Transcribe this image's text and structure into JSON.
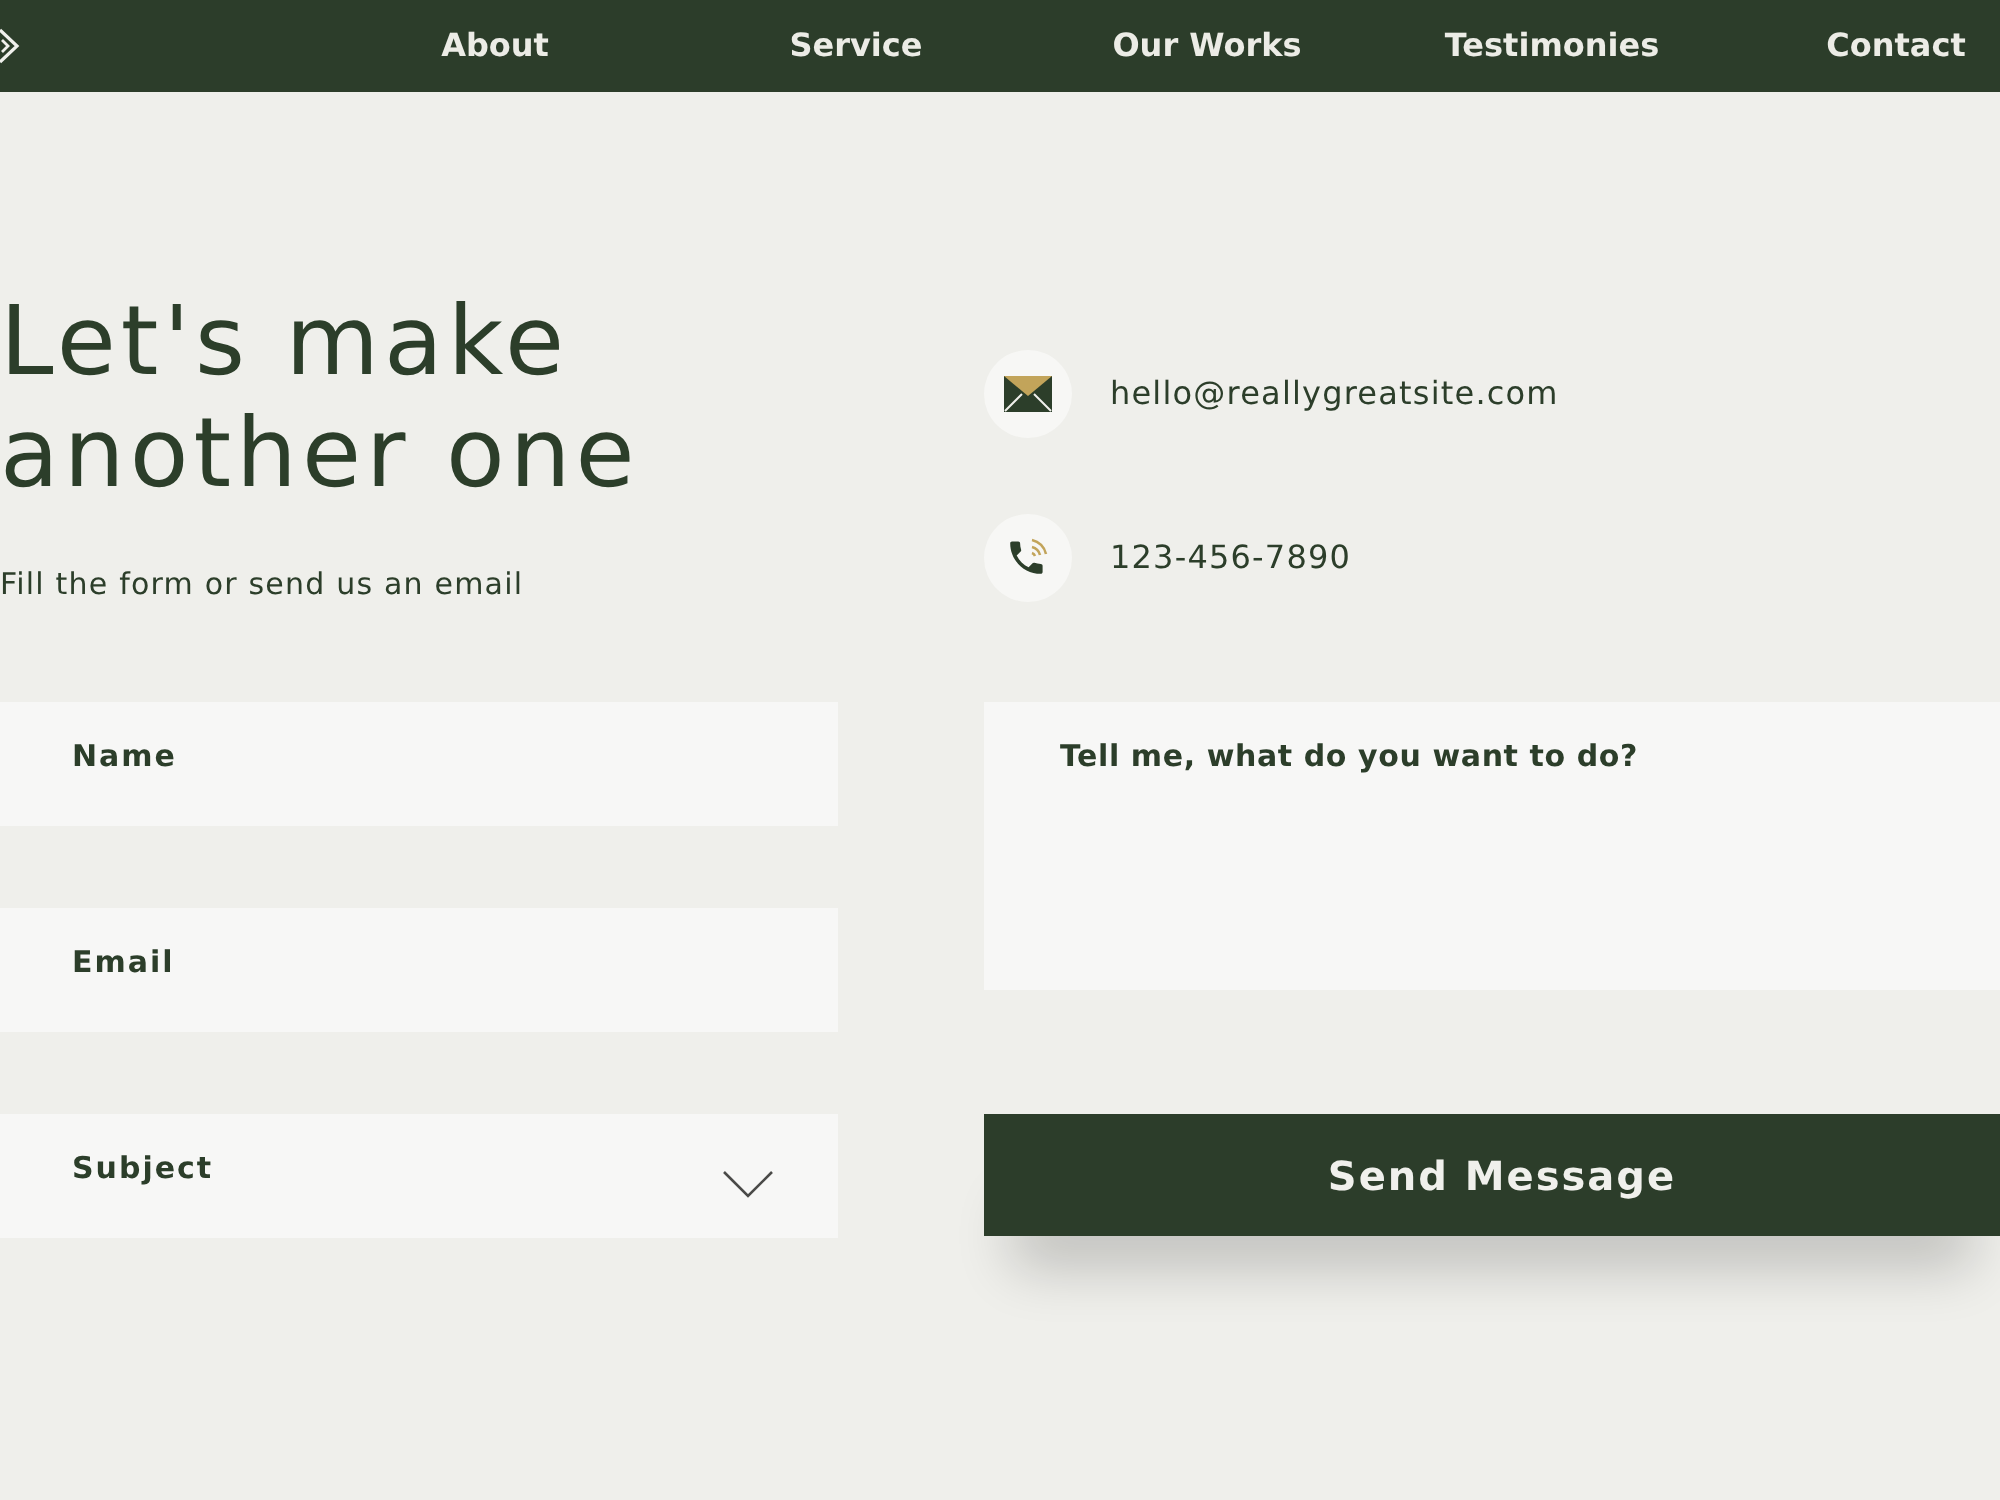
{
  "nav": {
    "items": [
      "About",
      "Service",
      "Our Works",
      "Testimonies",
      "Contact"
    ]
  },
  "hero": {
    "title": "Let's make another one",
    "subtitle": "Fill the form or send us an email"
  },
  "contacts": [
    {
      "kind": "email",
      "text": "hello@reallygreatsite.com"
    },
    {
      "kind": "phone",
      "text": "123-456-7890"
    }
  ],
  "form": {
    "fields": [
      {
        "kind": "text",
        "placeholder": "Name"
      },
      {
        "kind": "email",
        "placeholder": "Email"
      },
      {
        "kind": "select",
        "placeholder": "Subject"
      }
    ],
    "message": {
      "placeholder": "Tell me, what do you want to do?"
    },
    "submit": "Send Message"
  }
}
